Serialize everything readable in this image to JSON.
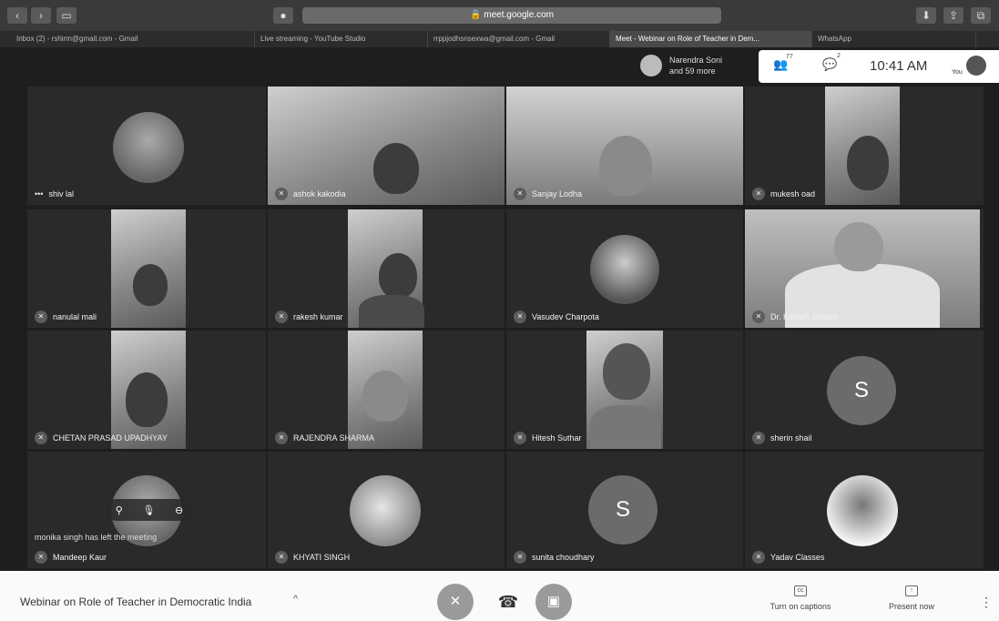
{
  "browser": {
    "address": "meet.google.com",
    "tabs": [
      {
        "label": "Inbox (2) - rshirm@gmail.com - Gmail"
      },
      {
        "label": "Live streaming - YouTube Studio"
      },
      {
        "label": "rrppjodhsnsexwa@gmail.com - Gmail"
      },
      {
        "label": "Meet - Webinar on Role of Teacher in Dem..."
      },
      {
        "label": "WhatsApp"
      }
    ]
  },
  "meet": {
    "pinned": {
      "name": "Narendra Soni",
      "more": "and 59 more"
    },
    "info": {
      "people_count": "77",
      "chat_count": "2",
      "time": "10:41 AM",
      "you": "You"
    },
    "tiles": [
      {
        "name": "shiv lal"
      },
      {
        "name": "ashok kakodia"
      },
      {
        "name": "Sanjay Lodha"
      },
      {
        "name": "mukesh oad"
      },
      {
        "name": "nanulal mali"
      },
      {
        "name": "rakesh kumar"
      },
      {
        "name": "Vasudev Charpota"
      },
      {
        "name": "Dr. Kailash Sodani"
      },
      {
        "name": "CHETAN PRASAD UPADHYAY"
      },
      {
        "name": "RAJENDRA SHARMA"
      },
      {
        "name": "Hitesh Suthar"
      },
      {
        "name": "sherin shail",
        "initial": "S"
      },
      {
        "name": "Mandeep Kaur"
      },
      {
        "name": "KHYATI SINGH"
      },
      {
        "name": "sunita choudhary",
        "initial": "S"
      },
      {
        "name": "Yadav Classes"
      }
    ],
    "left_message": "monika singh has left the meeting",
    "meeting_title": "Webinar on Role of Teacher in Democratic India",
    "captions_label": "Turn on captions",
    "present_label": "Present now"
  }
}
